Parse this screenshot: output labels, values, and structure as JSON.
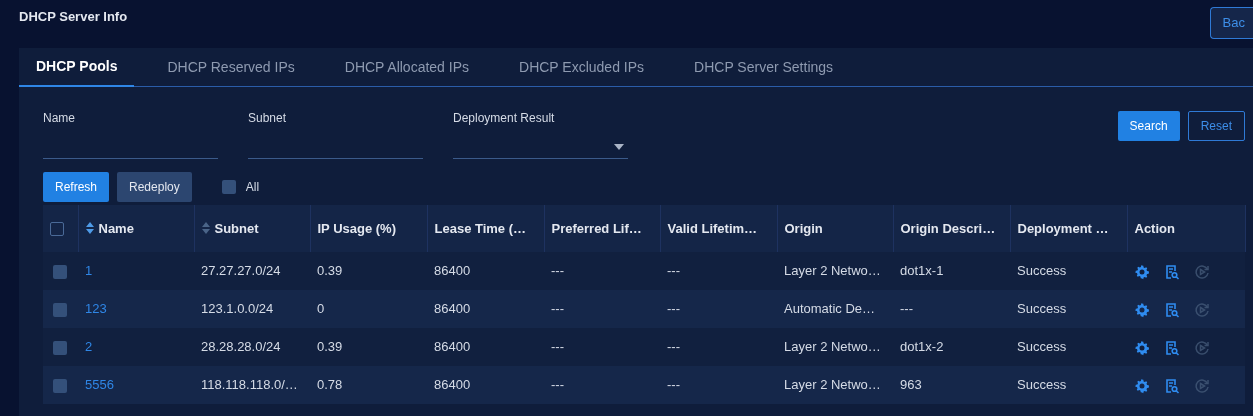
{
  "page_title": "DHCP Server Info",
  "back_button": "Bac",
  "tabs": [
    {
      "label": "DHCP Pools",
      "selected": true
    },
    {
      "label": "DHCP Reserved IPs",
      "selected": false
    },
    {
      "label": "DHCP Allocated IPs",
      "selected": false
    },
    {
      "label": "DHCP Excluded IPs",
      "selected": false
    },
    {
      "label": "DHCP Server Settings",
      "selected": false
    }
  ],
  "filters": [
    {
      "label": "Name",
      "kind": "text"
    },
    {
      "label": "Subnet",
      "kind": "text"
    },
    {
      "label": "Deployment Result",
      "kind": "select"
    }
  ],
  "search_button": "Search",
  "reset_button": "Reset",
  "toolbar": {
    "refresh": "Refresh",
    "redeploy": "Redeploy",
    "all_label": "All",
    "all_checked": false
  },
  "table": {
    "select_all_checked": false,
    "columns": [
      {
        "label": "Name",
        "sortable": true
      },
      {
        "label": "Subnet",
        "sortable": true
      },
      {
        "label": "IP Usage (%)",
        "sortable": false
      },
      {
        "label": "Lease Time (…",
        "sortable": false
      },
      {
        "label": "Preferred Lif…",
        "sortable": false
      },
      {
        "label": "Valid Lifetim…",
        "sortable": false
      },
      {
        "label": "Origin",
        "sortable": false
      },
      {
        "label": "Origin Descri…",
        "sortable": false
      },
      {
        "label": "Deployment …",
        "sortable": false
      },
      {
        "label": "Action",
        "sortable": false
      }
    ],
    "rows": [
      {
        "checked": false,
        "cells": [
          "1",
          "27.27.27.0/24",
          "0.39",
          "86400",
          "---",
          "---",
          "Layer 2 Netwo…",
          "dot1x-1",
          "Success"
        ],
        "actions": [
          {
            "kind": "settings",
            "disabled": false
          },
          {
            "kind": "details",
            "disabled": false
          },
          {
            "kind": "redeploy",
            "disabled": true
          }
        ]
      },
      {
        "checked": false,
        "cells": [
          "123",
          "123.1.0.0/24",
          "0",
          "86400",
          "---",
          "---",
          "Automatic De…",
          "---",
          "Success"
        ],
        "actions": [
          {
            "kind": "settings",
            "disabled": false
          },
          {
            "kind": "details",
            "disabled": false
          },
          {
            "kind": "redeploy",
            "disabled": true
          }
        ]
      },
      {
        "checked": false,
        "cells": [
          "2",
          "28.28.28.0/24",
          "0.39",
          "86400",
          "---",
          "---",
          "Layer 2 Netwo…",
          "dot1x-2",
          "Success"
        ],
        "actions": [
          {
            "kind": "settings",
            "disabled": false
          },
          {
            "kind": "details",
            "disabled": false
          },
          {
            "kind": "redeploy",
            "disabled": true
          }
        ]
      },
      {
        "checked": false,
        "cells": [
          "5556",
          "118.118.118.0/…",
          "0.78",
          "86400",
          "---",
          "---",
          "Layer 2 Netwo…",
          "963",
          "Success"
        ],
        "actions": [
          {
            "kind": "settings",
            "disabled": false
          },
          {
            "kind": "details",
            "disabled": false
          },
          {
            "kind": "redeploy",
            "disabled": true
          }
        ]
      }
    ]
  }
}
